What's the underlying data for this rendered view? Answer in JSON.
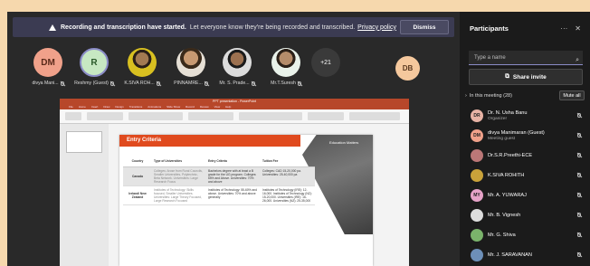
{
  "banner": {
    "bold": "Recording and transcription have started.",
    "message": "Let everyone know they're being recorded and transcribed.",
    "link": "Privacy policy",
    "dismiss": "Dismiss"
  },
  "strip": {
    "participants": [
      {
        "initials": "DM",
        "name": "divya Mani...",
        "style": "initials",
        "bg": "#f0a18a",
        "fg": "#5a2a1a"
      },
      {
        "initials": "R",
        "name": "Reshmy (Guest)",
        "style": "initials",
        "bg": "#c7e8c2",
        "fg": "#2b5a2a"
      },
      {
        "initials": "",
        "name": "K.SIVA ROH...",
        "style": "photo2"
      },
      {
        "initials": "",
        "name": "PINNAMRE...",
        "style": "photo"
      },
      {
        "initials": "",
        "name": "Mr. S. Prade...",
        "style": "photo3"
      },
      {
        "initials": "",
        "name": "Mr.T.Suresh",
        "style": "photo5"
      }
    ],
    "overflow": "+21",
    "self_initials": "DB"
  },
  "ppt": {
    "window_title": "PPT presentation - PowerPoint",
    "tabs": [
      "File",
      "Home",
      "Insert",
      "Draw",
      "Design",
      "Transitions",
      "Animations",
      "Slide Show",
      "Record",
      "Review",
      "View",
      "Help"
    ],
    "slide": {
      "heading": "Entry Criteria",
      "photo_label": "Education Matters",
      "columns": [
        "Country",
        "Type of Universities",
        "Entry Criteria",
        "Tuition Fee"
      ],
      "rows": [
        {
          "country": "Canada",
          "types": "Colleges: Arose from Rural Councils, Smaller Universities, Polytechnic, Beta Network. Universities: Large Research Focus",
          "criteria": "Bachelors degree with at least a B grade for the UG program. Colleges: 65% and Above. Universities: 70% and above",
          "fee": "Colleges: CAD 15-20,000 pa. Universities: 25-40,000 pa"
        },
        {
          "country": "Ireland/ New Zealand",
          "types": "Institutes of Technology: Skills focused, Smaller Universities. Universities: Large Theory Focused, Large Research Focused",
          "criteria": "Institutes of Technology: 55-60% and above. Universities: 70% and above generally",
          "fee": "Institutes of Technology (IRE): 12-16,000. Institutes of Technology (NZ): 15-20,000. Universities (IRE): 16-26,000. Universities (NZ): 25-35,000"
        }
      ]
    }
  },
  "panel": {
    "title": "Participants",
    "search_placeholder": "Type a name",
    "share_invite": "Share invite",
    "in_meeting": "In this meeting (28)",
    "mute_all": "Mute all",
    "people": [
      {
        "initials": "DR",
        "name": "Dr. N. Usha Banu",
        "sub": "Organizer",
        "bg": "#e8b3a5"
      },
      {
        "initials": "DM",
        "name": "divya Manimaran (Guest)",
        "sub": "Meeting guest",
        "bg": "#f0a18a"
      },
      {
        "initials": "",
        "name": "Dr.S.R.Preethi-ECE",
        "sub": "",
        "bg": "#b77"
      },
      {
        "initials": "",
        "name": "K.SIVA ROHITH",
        "sub": "",
        "bg": "#c9a23a"
      },
      {
        "initials": "MY",
        "name": "Mr. A. YUWARAJ",
        "sub": "",
        "bg": "#e6a3c8"
      },
      {
        "initials": "",
        "name": "Mr. B. Vignesh",
        "sub": "",
        "bg": "#ddd"
      },
      {
        "initials": "",
        "name": "Mr. G. Shiva",
        "sub": "",
        "bg": "#7ab36b"
      },
      {
        "initials": "",
        "name": "Mr. J. SARAVANAN",
        "sub": "",
        "bg": "#6d8fb8"
      }
    ]
  }
}
